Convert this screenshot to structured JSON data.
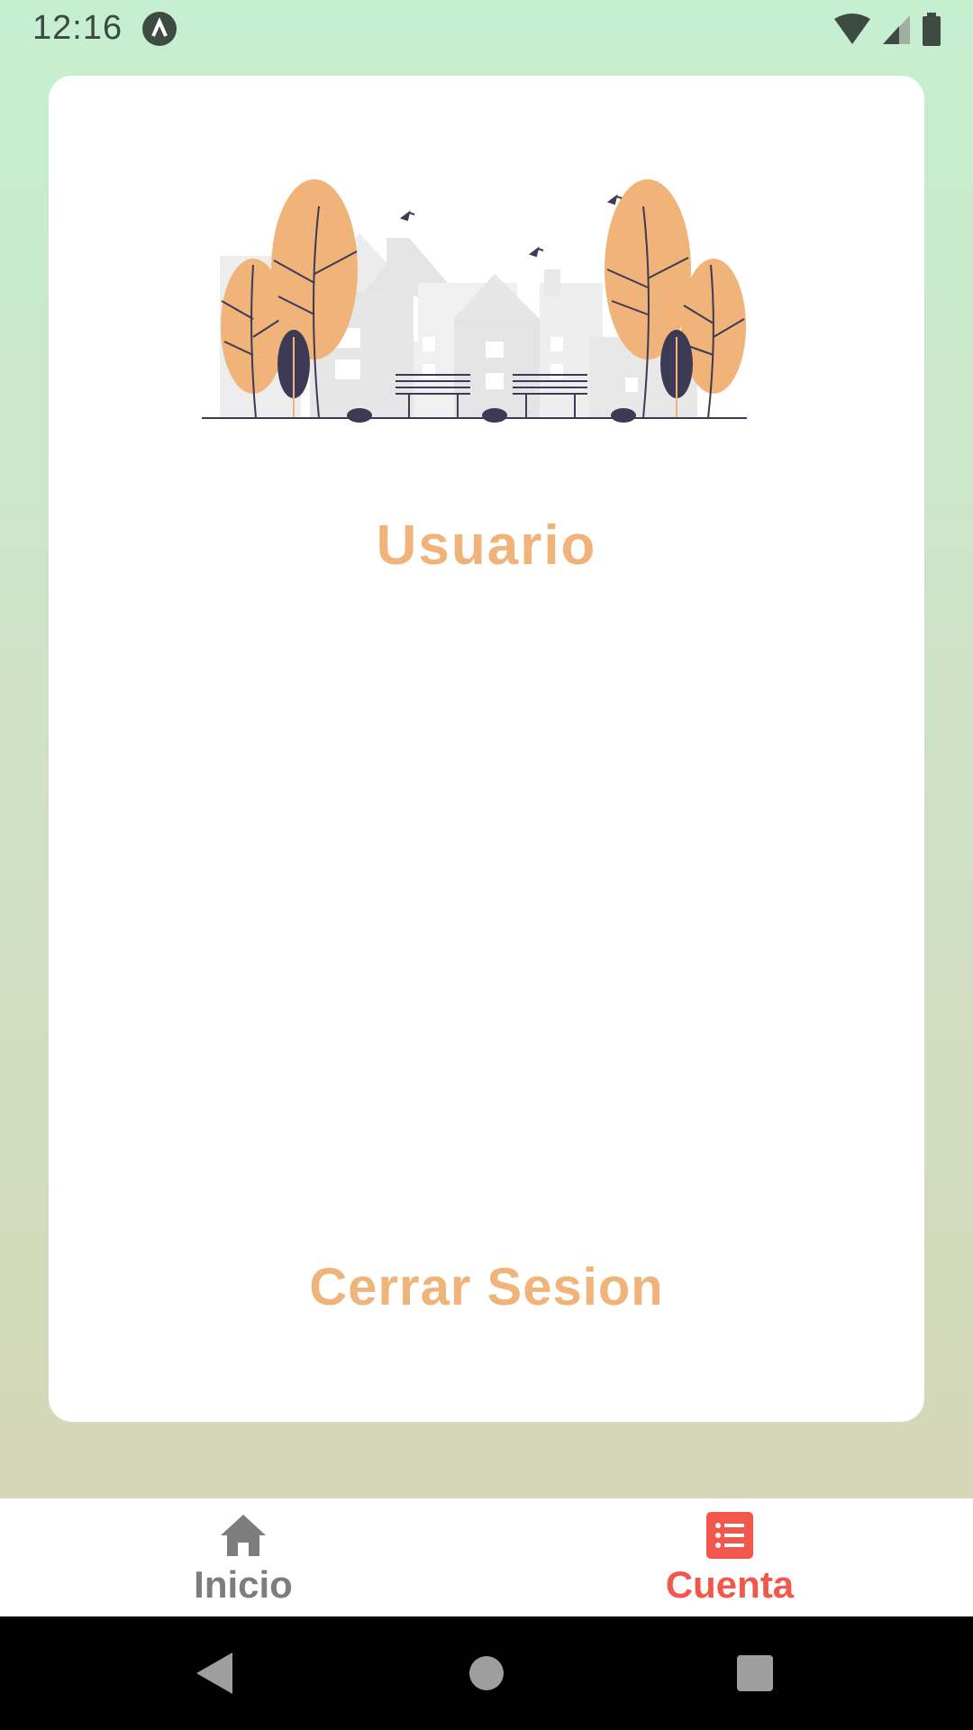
{
  "status_bar": {
    "time": "12:16",
    "icons": [
      "app-notification-icon",
      "wifi-icon",
      "signal-icon",
      "battery-icon"
    ]
  },
  "profile": {
    "title": "Usuario",
    "logout_label": "Cerrar Sesion"
  },
  "bottom_nav": {
    "items": [
      {
        "label": "Inicio",
        "icon": "home-icon",
        "active": false
      },
      {
        "label": "Cuenta",
        "icon": "list-icon",
        "active": true
      }
    ]
  },
  "system_nav": {
    "buttons": [
      "back-icon",
      "home-circle-icon",
      "recents-icon"
    ]
  },
  "colors": {
    "accent": "#f0b47a",
    "active_tab": "#f2574b",
    "inactive_tab": "#7d7d7d",
    "tree_dark": "#3d3a55"
  }
}
